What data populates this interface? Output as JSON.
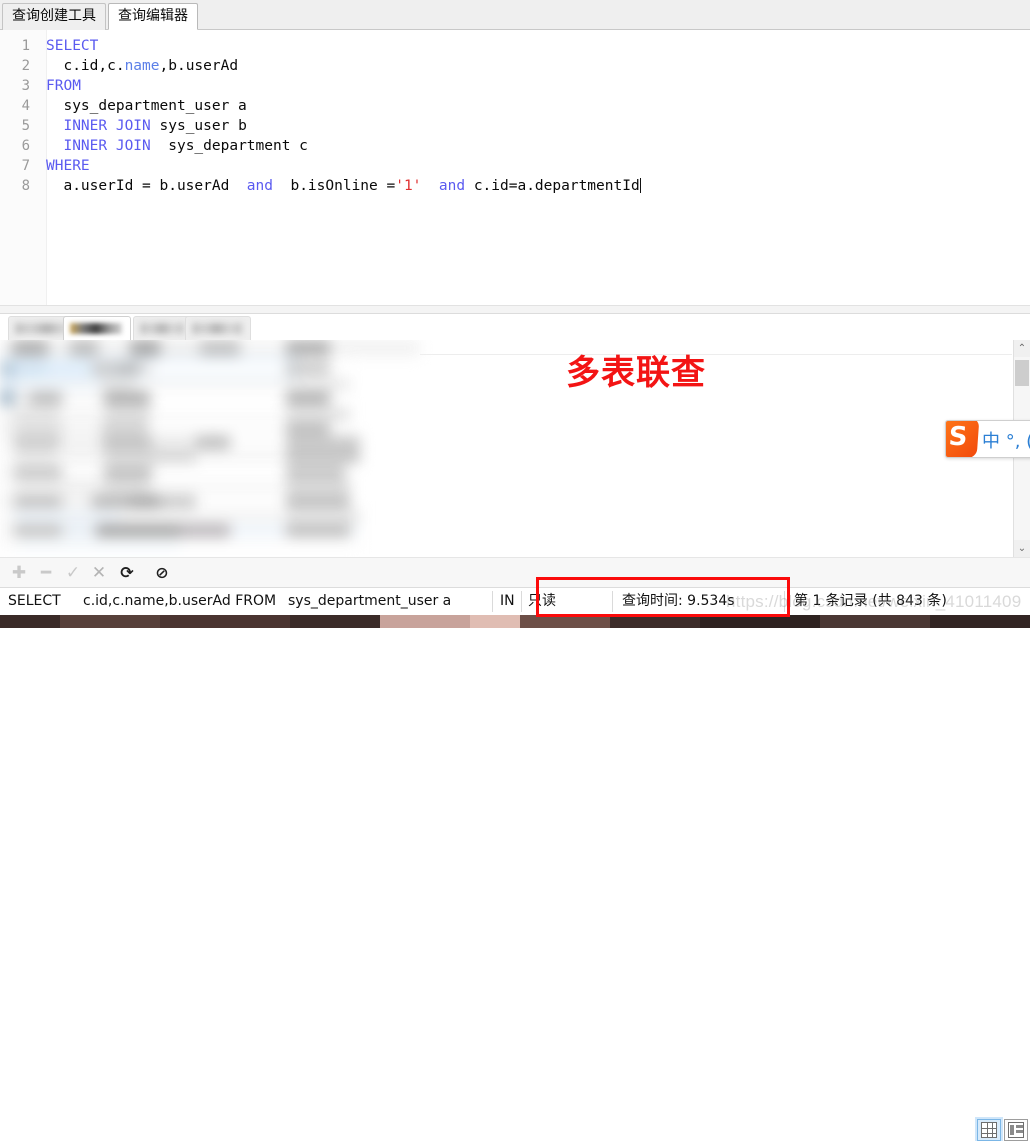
{
  "tabs": [
    {
      "label": "查询创建工具",
      "active": false
    },
    {
      "label": "查询编辑器",
      "active": true
    }
  ],
  "editor": {
    "lines": [
      {
        "num": "1",
        "tokens": [
          {
            "t": "SELECT",
            "c": "kw"
          }
        ]
      },
      {
        "num": "2",
        "tokens": [
          {
            "t": "  c.id,c.",
            "c": "op"
          },
          {
            "t": "name",
            "c": "id2"
          },
          {
            "t": ",b.userAd",
            "c": "op"
          }
        ]
      },
      {
        "num": "3",
        "tokens": [
          {
            "t": "FROM",
            "c": "kw"
          }
        ]
      },
      {
        "num": "4",
        "tokens": [
          {
            "t": "  sys_department_user a",
            "c": "op"
          }
        ]
      },
      {
        "num": "5",
        "tokens": [
          {
            "t": "  ",
            "c": "op"
          },
          {
            "t": "INNER JOIN",
            "c": "kw"
          },
          {
            "t": " sys_user b",
            "c": "op"
          }
        ]
      },
      {
        "num": "6",
        "tokens": [
          {
            "t": "  ",
            "c": "op"
          },
          {
            "t": "INNER JOIN",
            "c": "kw"
          },
          {
            "t": "  sys_department c",
            "c": "op"
          }
        ]
      },
      {
        "num": "7",
        "tokens": [
          {
            "t": "WHERE",
            "c": "kw"
          }
        ]
      },
      {
        "num": "8",
        "tokens": [
          {
            "t": "  a.userId = b.userAd  ",
            "c": "op"
          },
          {
            "t": "and",
            "c": "kw"
          },
          {
            "t": "  b.isOnline =",
            "c": "op"
          },
          {
            "t": "'1'",
            "c": "str"
          },
          {
            "t": "  ",
            "c": "op"
          },
          {
            "t": "and",
            "c": "kw"
          },
          {
            "t": " c.id=a.departmentId",
            "c": "op"
          }
        ],
        "caret": true
      }
    ]
  },
  "annotation": {
    "text": "多表联查",
    "color": "#f31414"
  },
  "ime": {
    "logo": "S",
    "text": "中 °, ("
  },
  "result_tabs": [
    {
      "label": "",
      "selected": false
    },
    {
      "label": "",
      "selected": true
    },
    {
      "label": "",
      "selected": false
    },
    {
      "label": "",
      "selected": false
    }
  ],
  "toolbar": {
    "icons": [
      {
        "name": "add-record-icon",
        "glyph": "✚",
        "state": "disabled"
      },
      {
        "name": "delete-record-icon",
        "glyph": "━",
        "state": "disabled"
      },
      {
        "name": "confirm-record-icon",
        "glyph": "✓",
        "state": "disabled"
      },
      {
        "name": "cancel-record-icon",
        "glyph": "✕",
        "state": "muted"
      },
      {
        "name": "refresh-icon",
        "glyph": "⟳",
        "state": "enabled"
      },
      {
        "name": "stop-icon",
        "glyph": "⊘",
        "state": "enabled"
      }
    ],
    "view_modes": [
      {
        "name": "grid-view",
        "selected": true
      },
      {
        "name": "form-view",
        "selected": false
      }
    ]
  },
  "statusbar": {
    "sql_keyword": "SELECT",
    "sql_columns": "c.id,c.name,b.userAd FROM",
    "sql_table": "sys_department_user a",
    "sql_join": "IN",
    "readonly": "只读",
    "query_time": "查询时间: 9.534s",
    "record_count": "第 1 条记录 (共 843 条)"
  },
  "watermark": "https://blog.csdn.net/weixin_41011409",
  "scrollbar": {
    "up_arrow": "⌃",
    "down_arrow": "⌄"
  },
  "colors": {
    "keyword": "#5a5af0",
    "string": "#e03030",
    "identifier": "#5b7fe8",
    "annotation_red": "#f31414",
    "redbox": "#fb0b0b",
    "ime_blue": "#2b7fd4",
    "ime_orange": "#f24a0c"
  }
}
